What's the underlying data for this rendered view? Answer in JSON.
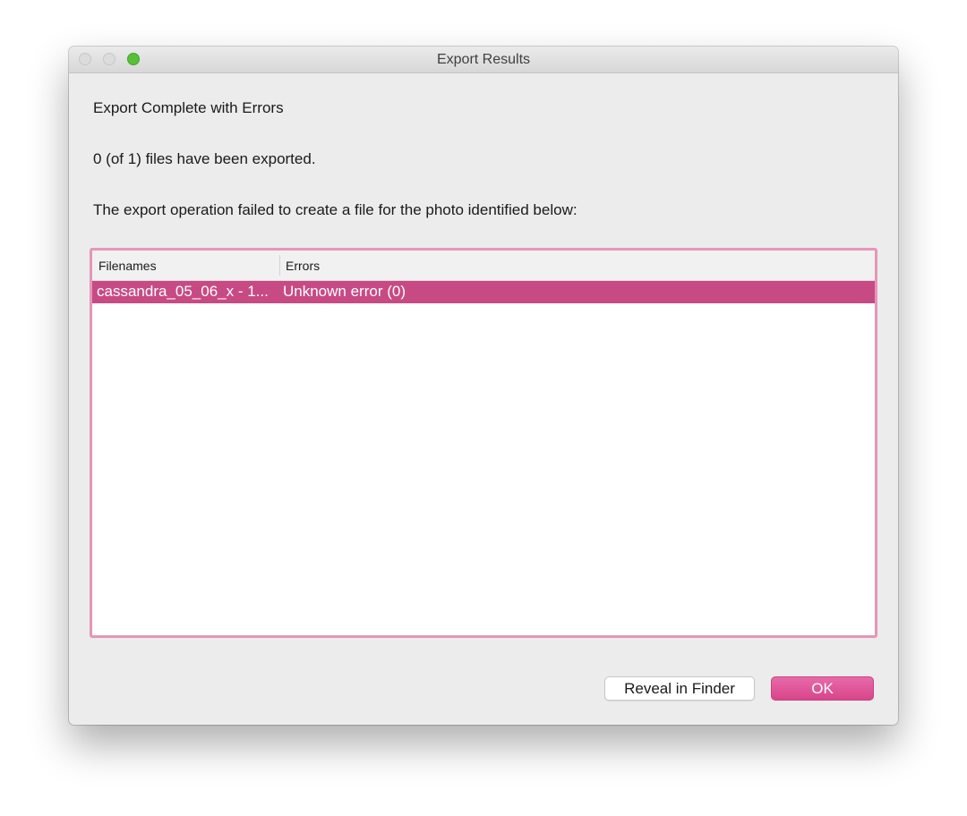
{
  "window": {
    "title": "Export Results"
  },
  "messages": {
    "heading": "Export Complete with Errors",
    "summary": "0 (of 1) files have been exported.",
    "detail": "The export operation failed to create a file for the photo identified below:"
  },
  "table": {
    "columns": [
      "Filenames",
      "Errors"
    ],
    "rows": [
      {
        "filename": "cassandra_05_06_x - 1...",
        "error": "Unknown error (0)"
      }
    ],
    "selected_row_color": "#c84a84"
  },
  "buttons": {
    "reveal_label": "Reveal in Finder",
    "ok_label": "OK"
  },
  "colors": {
    "accent": "#e05a9b",
    "zoom_button": "#57c038"
  }
}
